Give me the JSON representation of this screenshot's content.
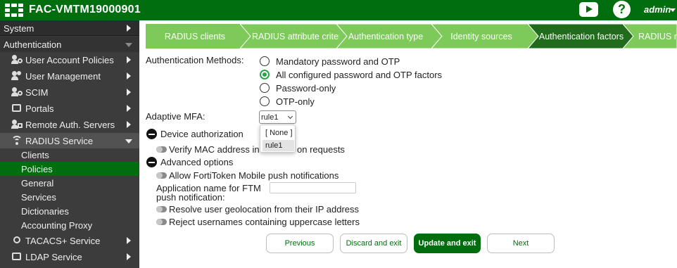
{
  "header": {
    "title": "FAC-VMTM19000901",
    "user": "admin",
    "help_label": "?"
  },
  "sidebar": {
    "items": [
      {
        "label": "System"
      },
      {
        "label": "Authentication"
      },
      {
        "label": "User Account Policies"
      },
      {
        "label": "User Management"
      },
      {
        "label": "SCIM"
      },
      {
        "label": "Portals"
      },
      {
        "label": "Remote Auth. Servers"
      },
      {
        "label": "RADIUS Service"
      },
      {
        "label": "Clients"
      },
      {
        "label": "Policies"
      },
      {
        "label": "General"
      },
      {
        "label": "Services"
      },
      {
        "label": "Dictionaries"
      },
      {
        "label": "Accounting Proxy"
      },
      {
        "label": "TACACS+ Service"
      },
      {
        "label": "LDAP Service"
      }
    ]
  },
  "steps": [
    {
      "label": "RADIUS clients"
    },
    {
      "label": "RADIUS attribute criteri"
    },
    {
      "label": "Authentication type"
    },
    {
      "label": "Identity sources"
    },
    {
      "label": "Authentication factors"
    },
    {
      "label": "RADIUS re"
    }
  ],
  "form": {
    "auth_methods_label": "Authentication Methods:",
    "auth_options": [
      {
        "label": "Mandatory password and OTP"
      },
      {
        "label": "All configured password and OTP factors"
      },
      {
        "label": "Password-only"
      },
      {
        "label": "OTP-only"
      }
    ],
    "selected_auth_option": "All configured password and OTP factors",
    "adaptive_mfa_label": "Adaptive MFA:",
    "adaptive_mfa_value": "rule1",
    "adaptive_mfa_options": [
      {
        "label": "[ None ]"
      },
      {
        "label": "rule1"
      }
    ],
    "device_auth_label": "Device authorization",
    "verify_mac_left": "Verify MAC address in au",
    "verify_mac_right": "on requests",
    "advanced_label": "Advanced options",
    "allow_ftm_label": "Allow FortiToken Mobile push notifications",
    "app_name_line1": "Application name for FTM",
    "app_name_line2": "push notification:",
    "app_name_value": "",
    "geo_label": "Resolve user geolocation from their IP address",
    "reject_upper_label": "Reject usernames containing uppercase letters"
  },
  "buttons": {
    "previous": "Previous",
    "discard": "Discard and exit",
    "update": "Update and exit",
    "next": "Next"
  },
  "colors": {
    "brand_green": "#006e0e",
    "step_light": "#7dc95a",
    "step_active": "#216c1c",
    "radio_green": "#2aa44a",
    "sidebar_bg": "#3c3c3c"
  }
}
